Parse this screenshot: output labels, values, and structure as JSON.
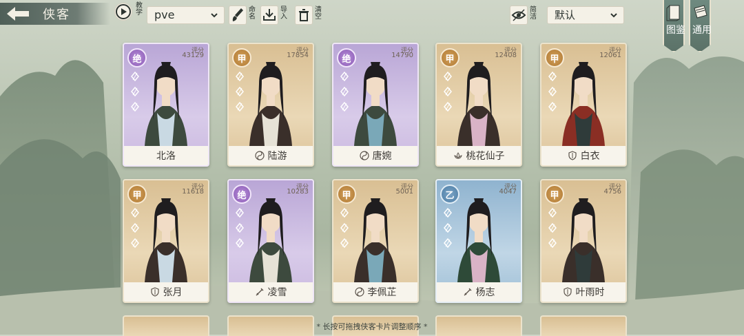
{
  "header": {
    "title": "侠客",
    "tutorial_label": "教学",
    "mode_select": "pve",
    "rename_label": "命名",
    "import_label": "导入",
    "clear_label": "清空",
    "compact_label": "简洁",
    "sort_select": "默认",
    "tab_gallery": "图鉴",
    "tab_general": "通用"
  },
  "cards": [
    {
      "name": "北洛",
      "grade": "绝",
      "score_label": "评分",
      "score": "43129",
      "rarity": "purple",
      "sect_icon": "none"
    },
    {
      "name": "陆游",
      "grade": "甲",
      "score_label": "评分",
      "score": "17854",
      "rarity": "gold",
      "sect_icon": "taiji-icon"
    },
    {
      "name": "唐婉",
      "grade": "绝",
      "score_label": "评分",
      "score": "14790",
      "rarity": "purple",
      "sect_icon": "taiji-icon"
    },
    {
      "name": "桃花仙子",
      "grade": "甲",
      "score_label": "评分",
      "score": "12408",
      "rarity": "gold",
      "sect_icon": "lotus-icon"
    },
    {
      "name": "白衣",
      "grade": "甲",
      "score_label": "评分",
      "score": "12061",
      "rarity": "gold",
      "sect_icon": "shield-icon"
    },
    {
      "name": "张月",
      "grade": "甲",
      "score_label": "评分",
      "score": "11618",
      "rarity": "gold",
      "sect_icon": "shield-icon"
    },
    {
      "name": "凌雪",
      "grade": "绝",
      "score_label": "评分",
      "score": "10283",
      "rarity": "purple",
      "sect_icon": "sword-icon"
    },
    {
      "name": "李佩芷",
      "grade": "甲",
      "score_label": "评分",
      "score": "5001",
      "rarity": "gold",
      "sect_icon": "taiji-icon"
    },
    {
      "name": "杨志",
      "grade": "乙",
      "score_label": "评分",
      "score": "4047",
      "rarity": "blue",
      "sect_icon": "sword-icon"
    },
    {
      "name": "叶雨时",
      "grade": "甲",
      "score_label": "评分",
      "score": "4756",
      "rarity": "gold",
      "sect_icon": "shield-icon"
    }
  ],
  "footer_hint": "* 长按可拖拽侠客卡片调整顺序 *"
}
